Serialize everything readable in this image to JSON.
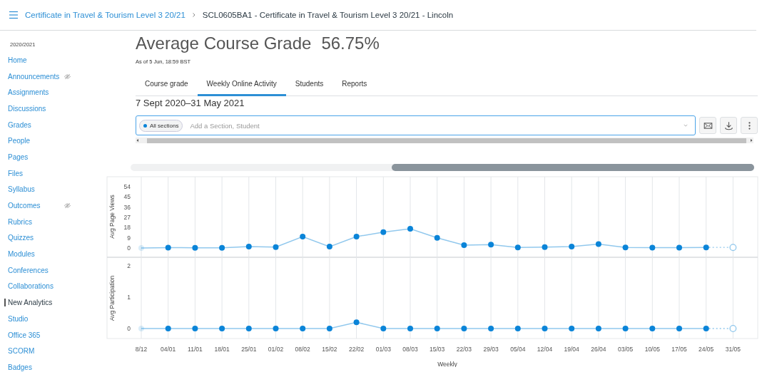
{
  "header": {
    "breadcrumb": [
      {
        "label": "Certificate in Travel & Tourism Level 3 20/21",
        "link": true
      },
      {
        "label": "SCL0605BA1 - Certificate in Travel & Tourism Level 3 20/21 - Lincoln",
        "link": false
      }
    ]
  },
  "sidebar": {
    "term": "2020/2021",
    "items": [
      {
        "label": "Home",
        "selected": false,
        "hidden": false
      },
      {
        "label": "Announcements",
        "selected": false,
        "hidden": true
      },
      {
        "label": "Assignments",
        "selected": false,
        "hidden": false
      },
      {
        "label": "Discussions",
        "selected": false,
        "hidden": false
      },
      {
        "label": "Grades",
        "selected": false,
        "hidden": false
      },
      {
        "label": "People",
        "selected": false,
        "hidden": false
      },
      {
        "label": "Pages",
        "selected": false,
        "hidden": false
      },
      {
        "label": "Files",
        "selected": false,
        "hidden": false
      },
      {
        "label": "Syllabus",
        "selected": false,
        "hidden": false
      },
      {
        "label": "Outcomes",
        "selected": false,
        "hidden": true
      },
      {
        "label": "Rubrics",
        "selected": false,
        "hidden": false
      },
      {
        "label": "Quizzes",
        "selected": false,
        "hidden": false
      },
      {
        "label": "Modules",
        "selected": false,
        "hidden": false
      },
      {
        "label": "Conferences",
        "selected": false,
        "hidden": false
      },
      {
        "label": "Collaborations",
        "selected": false,
        "hidden": false
      },
      {
        "label": "New Analytics",
        "selected": true,
        "hidden": false
      },
      {
        "label": "Studio",
        "selected": false,
        "hidden": false
      },
      {
        "label": "Office 365",
        "selected": false,
        "hidden": false
      },
      {
        "label": "SCORM",
        "selected": false,
        "hidden": false
      },
      {
        "label": "Badges",
        "selected": false,
        "hidden": false
      }
    ]
  },
  "page": {
    "title": "Average Course Grade",
    "grade": "56.75%",
    "as_of": "As of 5 Jun, 18:59 BST",
    "tabs": [
      {
        "label": "Course grade",
        "selected": false
      },
      {
        "label": "Weekly Online Activity",
        "selected": true
      },
      {
        "label": "Students",
        "selected": false
      },
      {
        "label": "Reports",
        "selected": false
      }
    ],
    "date_range": "7 Sept 2020–31 May 2021",
    "filter": {
      "chip": "All sections",
      "placeholder": "Add a Section, Student"
    },
    "actions": [
      {
        "kind": "message"
      },
      {
        "kind": "download"
      },
      {
        "kind": "more"
      }
    ]
  },
  "activity_chart": {
    "projected_last": true,
    "panels": [
      {
        "chart_data": {
          "type": "line",
          "ylabel": "Avg Page Views",
          "categories": [
            null,
            null,
            null,
            null,
            null,
            null,
            null,
            null,
            null,
            null,
            null,
            null,
            null,
            null,
            null,
            null,
            null,
            null,
            null,
            null,
            null,
            null,
            null
          ],
          "ylim": [
            0,
            54
          ],
          "yticks": [
            0,
            9,
            18,
            27,
            36,
            45,
            54
          ],
          "series": [
            {
              "color": "#0a84d8",
              "marker": "circle",
              "values": [
                0,
                0.3,
                0.2,
                0.2,
                1.2,
                0.8,
                10,
                1.2,
                10,
                14,
                17,
                9,
                2.5,
                3,
                0.5,
                0.8,
                1.2,
                3.5,
                0.4,
                0.3,
                0.3,
                0.5,
                0.5
              ]
            }
          ]
        }
      },
      {
        "chart_data": {
          "type": "line",
          "xlabel": "Weekly",
          "ylabel": "Avg Participation",
          "categories": [
            "8/12",
            "04/01",
            "11/01",
            "18/01",
            "25/01",
            "01/02",
            "08/02",
            "15/02",
            "22/02",
            "01/03",
            "08/03",
            "15/03",
            "22/03",
            "29/03",
            "05/04",
            "12/04",
            "19/04",
            "26/04",
            "03/05",
            "10/05",
            "17/05",
            "24/05",
            "31/05"
          ],
          "ylim": [
            0,
            2
          ],
          "yticks": [
            0,
            1,
            2
          ],
          "series": [
            {
              "color": "#0a84d8",
              "marker": "circle",
              "values": [
                0,
                0,
                0,
                0,
                0,
                0,
                0,
                0,
                0.2,
                0,
                0,
                0,
                0,
                0,
                0,
                0,
                0,
                0,
                0,
                0,
                0,
                0,
                0
              ]
            }
          ]
        }
      }
    ]
  }
}
